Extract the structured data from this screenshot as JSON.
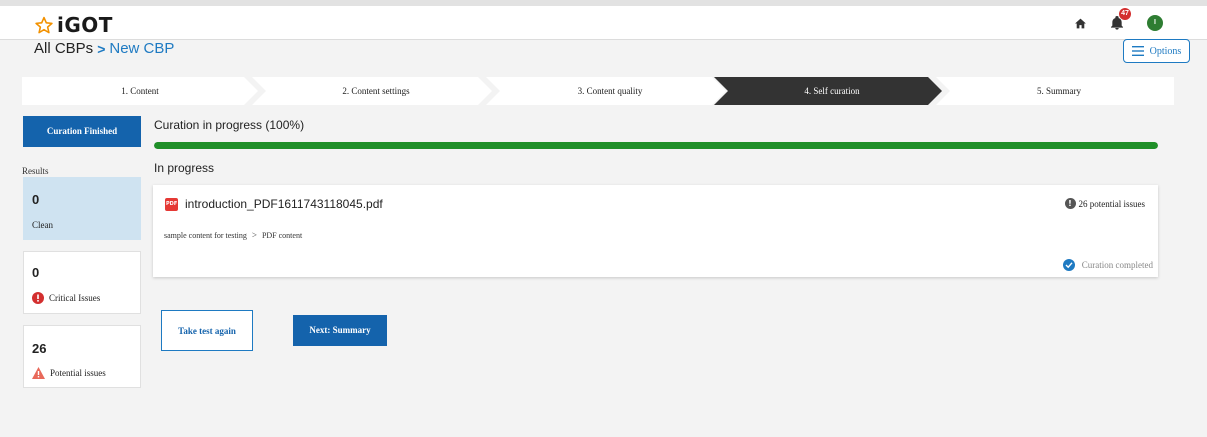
{
  "app": {
    "logo_text": "iGOT"
  },
  "header": {
    "notification_count": "47",
    "avatar_initial": "I"
  },
  "breadcrumb": {
    "root": "All CBPs",
    "separator": ">",
    "current": "New CBP"
  },
  "options": {
    "label": "Options"
  },
  "steps": [
    {
      "label": "1. Content",
      "active": false
    },
    {
      "label": "2. Content settings",
      "active": false
    },
    {
      "label": "3. Content quality",
      "active": false
    },
    {
      "label": "4. Self curation",
      "active": true
    },
    {
      "label": "5. Summary",
      "active": false
    }
  ],
  "sidebar": {
    "curation_button": "Curation Finished",
    "results_label": "Results",
    "cards": {
      "clean": {
        "count": "0",
        "label": "Clean"
      },
      "critical": {
        "count": "0",
        "label": "Critical Issues"
      },
      "potential": {
        "count": "26",
        "label": "Potential issues"
      }
    }
  },
  "main": {
    "progress_title": "Curation in progress (100%)",
    "progress_fraction": 1.0,
    "status_heading": "In progress",
    "file": {
      "name": "introduction_PDF1611743118045.pdf",
      "issues": "26 potential issues",
      "path_part1": "sample content for testing",
      "path_sep": ">",
      "path_part2": "PDF content",
      "status": "Curation completed"
    },
    "buttons": {
      "retake": "Take test again",
      "next": "Next: Summary"
    }
  },
  "colors": {
    "primary": "#1463ac",
    "link": "#1e7ac2",
    "progress": "#1f8f28",
    "active_step": "#333333",
    "clean_card": "#cfe3f1",
    "critical": "#d32f2f",
    "warning": "#e8695a"
  },
  "icons": {
    "logo": "star-outline-icon",
    "home": "home-icon",
    "notifications": "bell-icon",
    "options": "menu-icon",
    "file": "pdf-icon",
    "critical": "error-icon",
    "potential": "warning-icon",
    "issues": "info-icon",
    "completed": "check-circle-icon"
  }
}
